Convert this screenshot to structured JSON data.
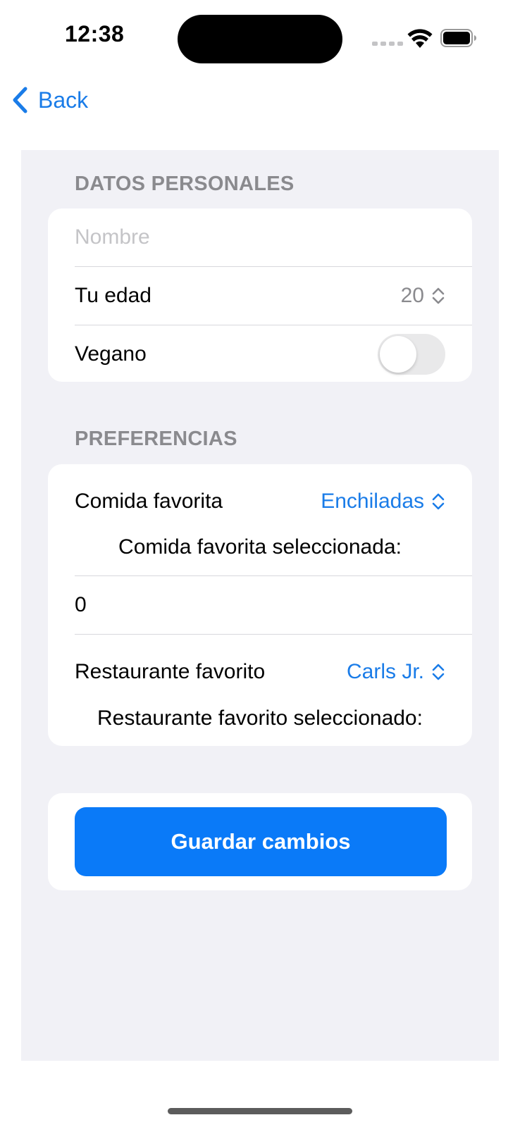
{
  "status_bar": {
    "time": "12:38",
    "icons": [
      "signal-dots-icon",
      "wifi-icon",
      "battery-icon"
    ]
  },
  "nav": {
    "back_label": "Back",
    "back_icon": "chevron-left-icon"
  },
  "sections": {
    "personal": {
      "header": "DATOS PERSONALES",
      "name_placeholder": "Nombre",
      "name_value": "",
      "age_label": "Tu edad",
      "age_value": "20",
      "vegan_label": "Vegano",
      "vegan_on": false
    },
    "preferences": {
      "header": "PREFERENCIAS",
      "food_label": "Comida favorita",
      "food_value": "Enchiladas",
      "food_selected_label": "Comida favorita seleccionada:",
      "count_value": "0",
      "restaurant_label": "Restaurante favorito",
      "restaurant_value": "Carls Jr.",
      "restaurant_selected_label": "Restaurante favorito seleccionado:"
    }
  },
  "actions": {
    "save_label": "Guardar cambios"
  },
  "colors": {
    "accent": "#1a7ce8",
    "button": "#0a7af8",
    "grouped_background": "#f1f1f6",
    "secondary_text": "#8a8a8e"
  }
}
